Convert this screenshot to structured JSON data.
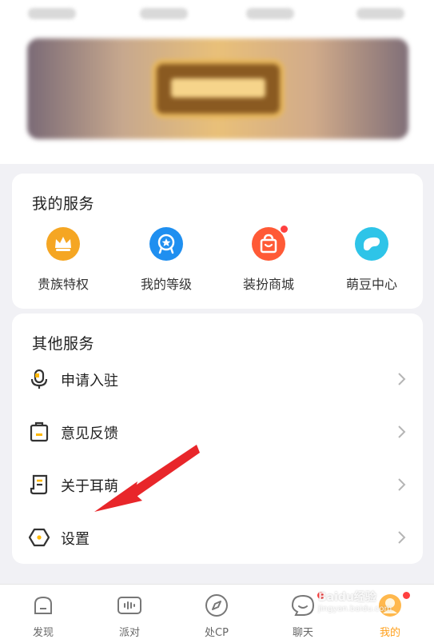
{
  "my_services": {
    "title": "我的服务",
    "items": [
      {
        "label": "贵族特权",
        "icon": "crown-icon",
        "color": "#f5a623",
        "badge": false
      },
      {
        "label": "我的等级",
        "icon": "level-medal-icon",
        "color": "#1f8ff0",
        "badge": false
      },
      {
        "label": "装扮商城",
        "icon": "shopping-bag-icon",
        "color": "#ff5a36",
        "badge": true
      },
      {
        "label": "萌豆中心",
        "icon": "bean-icon",
        "color": "#2ec4e8",
        "badge": false
      }
    ]
  },
  "other_services": {
    "title": "其他服务",
    "items": [
      {
        "label": "申请入驻",
        "icon": "microphone-icon"
      },
      {
        "label": "意见反馈",
        "icon": "clipboard-icon"
      },
      {
        "label": "关于耳萌",
        "icon": "document-icon"
      },
      {
        "label": "设置",
        "icon": "gear-hexagon-icon"
      }
    ]
  },
  "tabbar": {
    "tabs": [
      {
        "label": "发现",
        "icon": "discover-icon",
        "active": false,
        "badge": false
      },
      {
        "label": "派对",
        "icon": "party-icon",
        "active": false,
        "badge": false
      },
      {
        "label": "处CP",
        "icon": "compass-icon",
        "active": false,
        "badge": false
      },
      {
        "label": "聊天",
        "icon": "chat-icon",
        "active": false,
        "badge": true
      },
      {
        "label": "我的",
        "icon": "avatar-icon",
        "active": true,
        "badge": true
      }
    ]
  },
  "watermark": {
    "line1": "Baidu经验",
    "line2": "jingyan.baidu.com"
  },
  "colors": {
    "accent": "#ff9f1a",
    "badge": "#ff4040",
    "annotation_arrow": "#e8262a"
  }
}
